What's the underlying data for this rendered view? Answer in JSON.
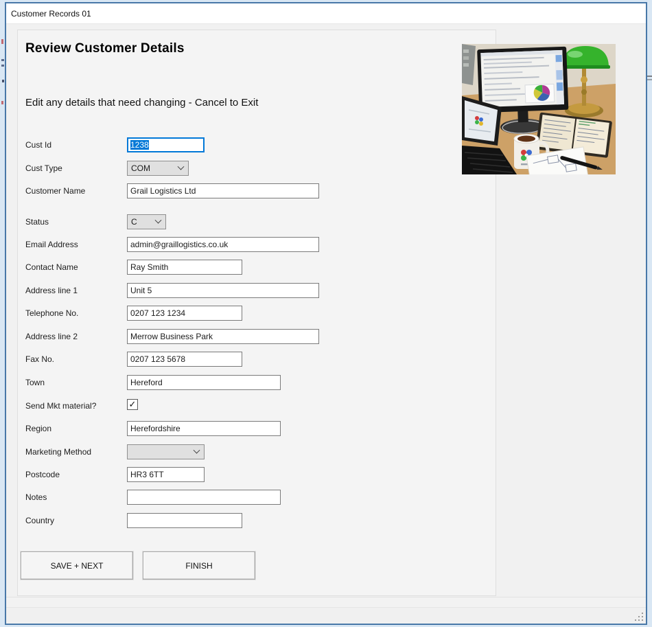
{
  "window": {
    "title": "Customer Records 01"
  },
  "header": {
    "title": "Review Customer Details",
    "subtitle": "Edit any details that need changing - Cancel to Exit"
  },
  "form": {
    "fields": [
      {
        "label": "Cust Id",
        "value": "1238",
        "type": "text-selected"
      },
      {
        "label": "Cust Type",
        "value": "COM",
        "type": "combo"
      },
      {
        "label": "Customer Name",
        "value": "Grail Logistics Ltd",
        "type": "text"
      },
      {
        "label": "Status",
        "value": "C",
        "type": "combo"
      },
      {
        "label": "Email Address",
        "value": "admin@graillogistics.co.uk",
        "type": "text"
      },
      {
        "label": "Contact Name",
        "value": "Ray Smith",
        "type": "text"
      },
      {
        "label": "Address line 1",
        "value": "Unit 5",
        "type": "text"
      },
      {
        "label": "Telephone No.",
        "value": "0207 123 1234",
        "type": "text"
      },
      {
        "label": "Address line 2",
        "value": "Merrow Business Park",
        "type": "text"
      },
      {
        "label": "Fax No.",
        "value": "0207 123 5678",
        "type": "text"
      },
      {
        "label": "Town",
        "value": "Hereford",
        "type": "text"
      },
      {
        "label": "Send Mkt material?",
        "checked": true,
        "type": "checkbox"
      },
      {
        "label": "Region",
        "value": "Herefordshire",
        "type": "text"
      },
      {
        "label": "Marketing Method",
        "value": "",
        "type": "combo"
      },
      {
        "label": "Postcode",
        "value": "HR3 6TT",
        "type": "text"
      },
      {
        "label": "Notes",
        "value": "",
        "type": "text"
      },
      {
        "label": "Country",
        "value": "",
        "type": "text"
      }
    ]
  },
  "buttons": {
    "save_next": "SAVE + NEXT",
    "finish": "FINISH"
  },
  "icons": {
    "checkmark": "✓"
  },
  "photo": {
    "alt": "desk workspace photo: monitor, laptop, green banker's lamp, notebook, mug, pen"
  },
  "colors": {
    "accent": "#0078d7",
    "selection": "#0078d7",
    "window_border": "#4878a8",
    "titlebar_bg": "#ffffff",
    "client_bg": "#f1f1f1"
  }
}
